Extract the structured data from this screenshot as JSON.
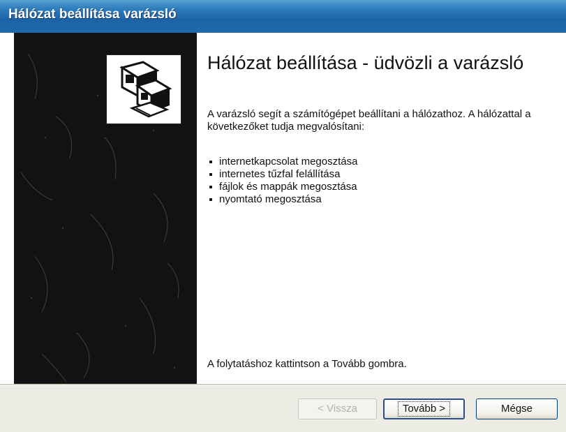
{
  "window": {
    "title": "Hálózat beállítása varázsló"
  },
  "main": {
    "heading": "Hálózat beállítása - üdvözli a varázsló",
    "intro": "A varázsló segít a számítógépet beállítani a hálózathoz. A hálózattal a következőket tudja megvalósítani:",
    "bullets": [
      "internetkapcsolat megosztása",
      "internetes tűzfal felállítása",
      "fájlok és mappák megosztása",
      "nyomtató megosztása"
    ],
    "footer": "A folytatáshoz kattintson a Tovább gombra."
  },
  "buttons": {
    "back": "< Vissza",
    "next": "Tovább >",
    "cancel": "Mégse"
  },
  "icon": "network-computers-icon",
  "colors": {
    "titlebar": "#1c63a6",
    "sidepanel": "#121212",
    "content_bg": "#ffffff"
  }
}
